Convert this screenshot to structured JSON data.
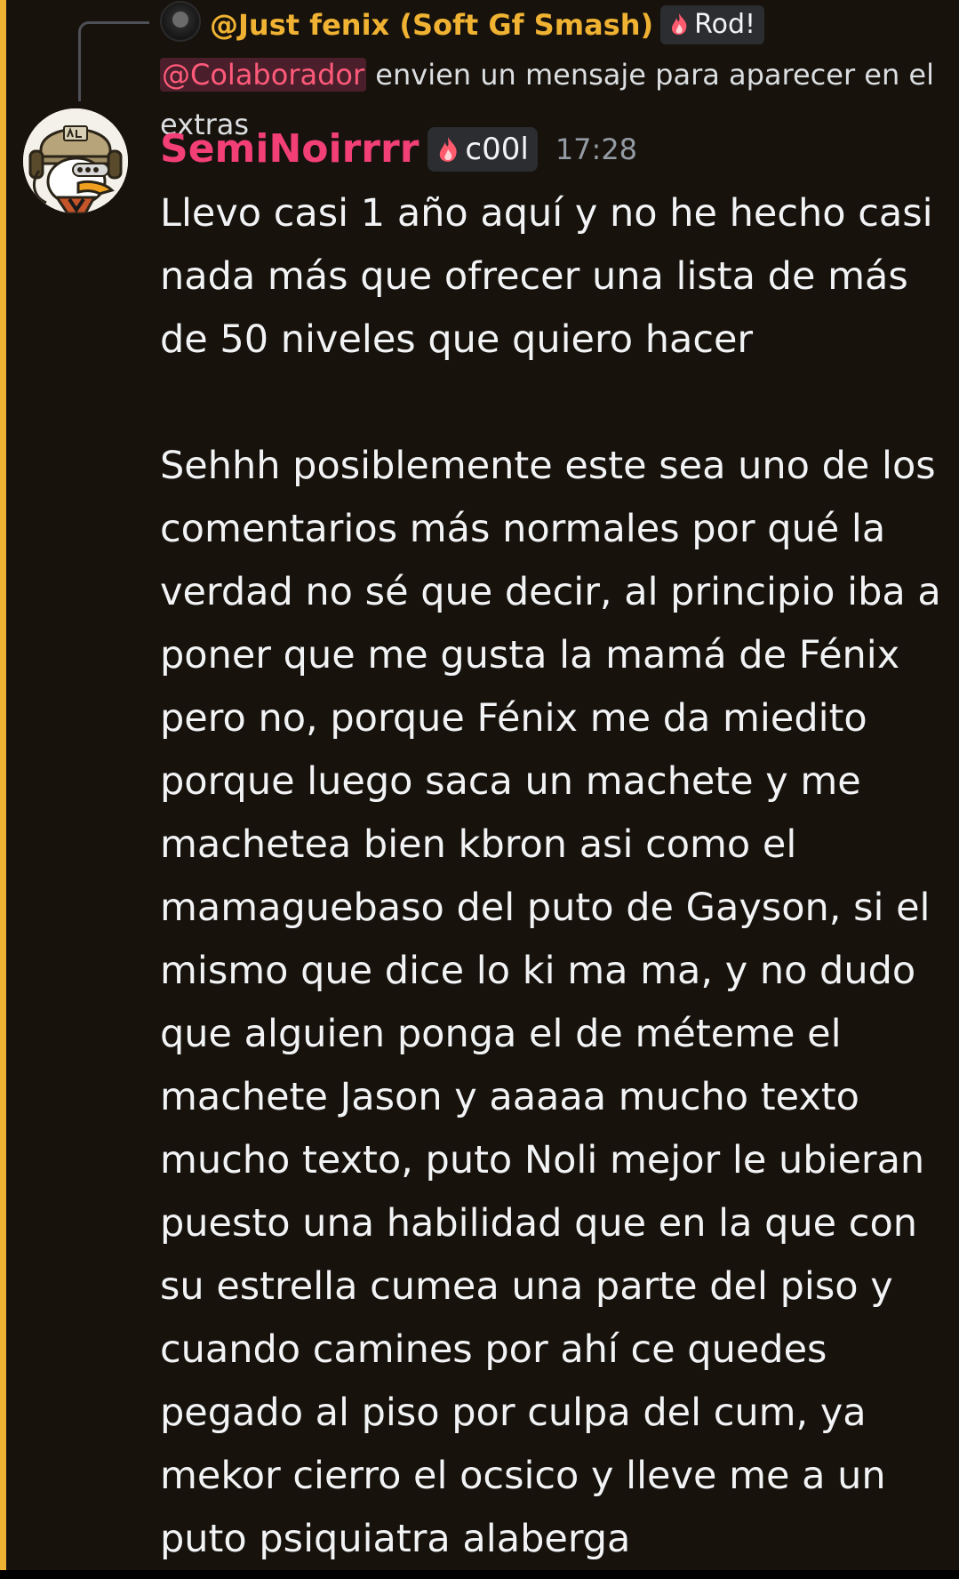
{
  "reply": {
    "author": "@Just fenix (Soft Gf Smash)",
    "role_label": "Rod!",
    "mention": "@Colaborador",
    "text": " envien un mensaje para aparecer en el extras"
  },
  "message": {
    "author": "SemiNoirrrr",
    "tag": "c00l",
    "timestamp": "17:28",
    "content": "Llevo casi 1 año aquí y no he hecho casi nada más que ofrecer una lista de más de 50 niveles que quiero hacer\n\nSehhh posiblemente este sea uno de los comentarios más normales por qué la verdad no sé que decir, al principio iba a poner que me gusta la mamá de Fénix pero no, porque Fénix me da miedito porque luego saca un machete y me machetea bien kbron asi como el mamaguebaso del puto de Gayson, si el mismo que dice lo ki ma ma, y no dudo que alguien ponga el de méteme el machete Jason y aaaaa mucho texto mucho texto, puto Noli mejor le ubieran puesto una habilidad que en la que con su estrella cumea una parte del piso y cuando camines por ahí ce quedes pegado al piso por culpa del cum, ya mekor cierro el ocsico y lleve me a un puto psiquiatra alaberga"
  },
  "colors": {
    "background": "#17120c",
    "mention_highlight_bar": "#f0b232",
    "author_name": "#f23f75",
    "reply_author": "#f0b232",
    "mention_text": "#ff5a7a",
    "timestamp": "#949ba4",
    "body_text": "#f2f3f5"
  },
  "icons": {
    "role_icon": "flame-icon",
    "reply_connector": "reply-spine"
  }
}
